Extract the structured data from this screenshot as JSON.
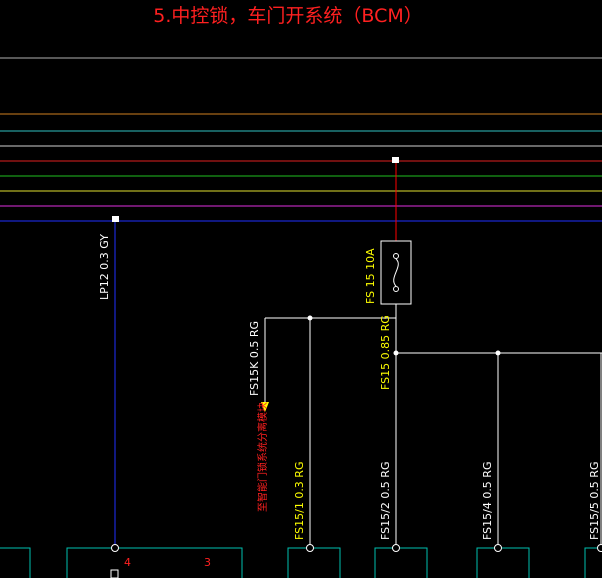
{
  "title": "5.中控锁，车门开系统（BCM）",
  "colors": {
    "background": "#000000",
    "wire_white": "#ffffff",
    "wire_red": "#ff0000",
    "wire_blue": "#2030ff",
    "label_yellow": "#ffff00",
    "label_red": "#ff2020",
    "connector_teal": "#00c0b0"
  },
  "bus_line_colors": [
    "#b0b0b0",
    "#d08020",
    "#30c0c0",
    "#d0d0d0",
    "#e02020",
    "#20c020",
    "#e0e030",
    "#e030e0",
    "#2030ff"
  ],
  "labels": {
    "lp12": "LP12  0.3  GY",
    "fs15k": "FS15K  0.5  RG",
    "fuse": "FS  15  10A",
    "fs15_trunk": "FS15  0.85  RG",
    "fs15_1": "FS15/1  0.3  RG",
    "fs15_2": "FS15/2  0.5  RG",
    "fs15_4": "FS15/4  0.5  RG",
    "fs15_5": "FS15/5  0.5  RG",
    "red_note": "至智能门锁系统分离模块",
    "pin_4": "4",
    "pin_3": "3"
  }
}
